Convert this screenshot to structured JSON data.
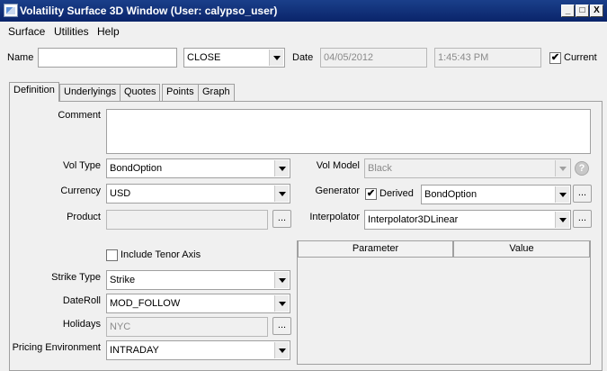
{
  "window": {
    "title": "Volatility Surface 3D Window (User: calypso_user)",
    "min_glyph": "_",
    "max_glyph": "□",
    "close_glyph": "X"
  },
  "menu": [
    "Surface",
    "Utilities",
    "Help"
  ],
  "header": {
    "name_label": "Name",
    "name_value": "",
    "quote_set": "CLOSE",
    "date_label": "Date",
    "date_value": "04/05/2012",
    "time_value": "1:45:43 PM",
    "current_label": "Current",
    "current_checked": true
  },
  "tabs": [
    "Definition",
    "Underlyings",
    "Quotes",
    "Points",
    "Graph"
  ],
  "definition": {
    "comment_label": "Comment",
    "comment_value": "",
    "vol_type_label": "Vol Type",
    "vol_type": "BondOption",
    "currency_label": "Currency",
    "currency": "USD",
    "product_label": "Product",
    "product": "",
    "include_tenor_label": "Include Tenor Axis",
    "include_tenor_checked": false,
    "strike_type_label": "Strike Type",
    "strike_type": "Strike",
    "dateroll_label": "DateRoll",
    "dateroll": "MOD_FOLLOW",
    "holidays_label": "Holidays",
    "holidays": "NYC",
    "pricing_env_label": "Pricing Environment",
    "pricing_env": "INTRADAY",
    "vol_model_label": "Vol Model",
    "vol_model": "Black",
    "generator_label": "Generator",
    "derived_label": "Derived",
    "derived_checked": true,
    "generator": "BondOption",
    "interpolator_label": "Interpolator",
    "interpolator": "Interpolator3DLinear",
    "ellipsis": "...",
    "help_glyph": "?",
    "check_glyph": "✔",
    "params_table": {
      "columns": [
        "Parameter",
        "Value"
      ],
      "rows": []
    }
  }
}
